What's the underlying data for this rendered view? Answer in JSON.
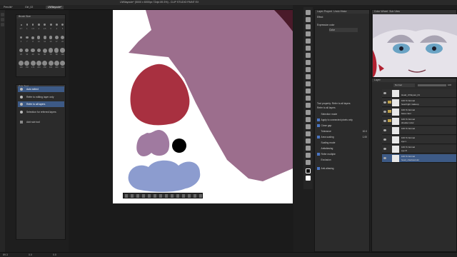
{
  "tabs": [
    {
      "label": "Pencils*",
      "active": false
    },
    {
      "label": "Girl_02",
      "active": false
    },
    {
      "label": "UWilayoute*",
      "active": true
    }
  ],
  "title": "UWilayoute* (5000 x 6000px 72dpi 89.3%) - CLIP STUDIO PAINT EX",
  "brush_panel": {
    "title": "Brush Size",
    "sizes": [
      "0.7",
      "1",
      "1.5",
      "2",
      "2.5",
      "3",
      "4",
      "5",
      "6",
      "7",
      "8",
      "10",
      "12",
      "15",
      "17",
      "20",
      "25",
      "30",
      "40",
      "50",
      "60",
      "70",
      "80",
      "100",
      "120",
      "150",
      "170",
      "200",
      "250",
      "300",
      "400",
      "500"
    ]
  },
  "subtool_panel": {
    "title": "Sub Tool",
    "items": [
      {
        "label": "Auto select",
        "selected": true
      },
      {
        "label": "Refer to editing layer only",
        "selected": false
      },
      {
        "label": "Refer to all layers",
        "selected": true
      },
      {
        "label": "Selection for referred layers",
        "selected": false
      }
    ],
    "add_label": "Add sub tool"
  },
  "tool_props": {
    "header_tab": "Layer Propert",
    "header_tab2": "Undo Histor",
    "effect_label": "Effect",
    "expression_label": "Expression color",
    "expression_value": "Color",
    "subtool_name": "Tool property: Refer to all layers",
    "refer_label": "Refer to all layers",
    "rows": [
      {
        "label": "Selection mode",
        "checked": false
      },
      {
        "label": "Apply to connected pixels only",
        "checked": true
      },
      {
        "label": "Close gap",
        "checked": true
      },
      {
        "label": "Tolerance",
        "checked": false,
        "value": "10.0"
      },
      {
        "label": "Area scaling",
        "checked": true,
        "value": "1.00"
      },
      {
        "label": "Scaling mode",
        "checked": false
      },
      {
        "label": "Antialiasing",
        "checked": false
      },
      {
        "label": "Refer multiple",
        "checked": true
      },
      {
        "label": "Exclusion",
        "checked": false
      },
      {
        "label": "Anti-aliasing",
        "checked": true
      }
    ]
  },
  "navigator": {
    "tab1": "Color Wheel",
    "tab2": "Sub View"
  },
  "layers": {
    "tab": "Layer",
    "blend": "Normal",
    "opacity": "100",
    "rows": [
      {
        "pct": "",
        "name": "Head_UVlayout_01",
        "folder": false,
        "selected": false
      },
      {
        "pct": "100 % Normal",
        "name": "head light makeup",
        "folder": true,
        "selected": false
      },
      {
        "pct": "100 % Normal",
        "name": "base color",
        "folder": true,
        "selected": false
      },
      {
        "pct": "100 % Normal",
        "name": "shadow color",
        "folder": true,
        "selected": false
      },
      {
        "pct": "100 % Normal",
        "name": "",
        "folder": false,
        "selected": false
      },
      {
        "pct": "100 % Normal",
        "name": "eye L",
        "folder": false,
        "selected": false
      },
      {
        "pct": "100 % Normal",
        "name": "eye R",
        "folder": false,
        "selected": false
      },
      {
        "pct": "100 % Normal",
        "name": "head_shadowcolor",
        "folder": false,
        "selected": true
      }
    ]
  },
  "status": {
    "zoom": "89.3",
    "angle": "0.0",
    "coords": "0.0"
  },
  "colors": {
    "purple": "#9c6e8d",
    "red": "#a83040",
    "mauve": "#a07aa0",
    "blue": "#8c9ccf",
    "accent": "#3d5a86"
  }
}
